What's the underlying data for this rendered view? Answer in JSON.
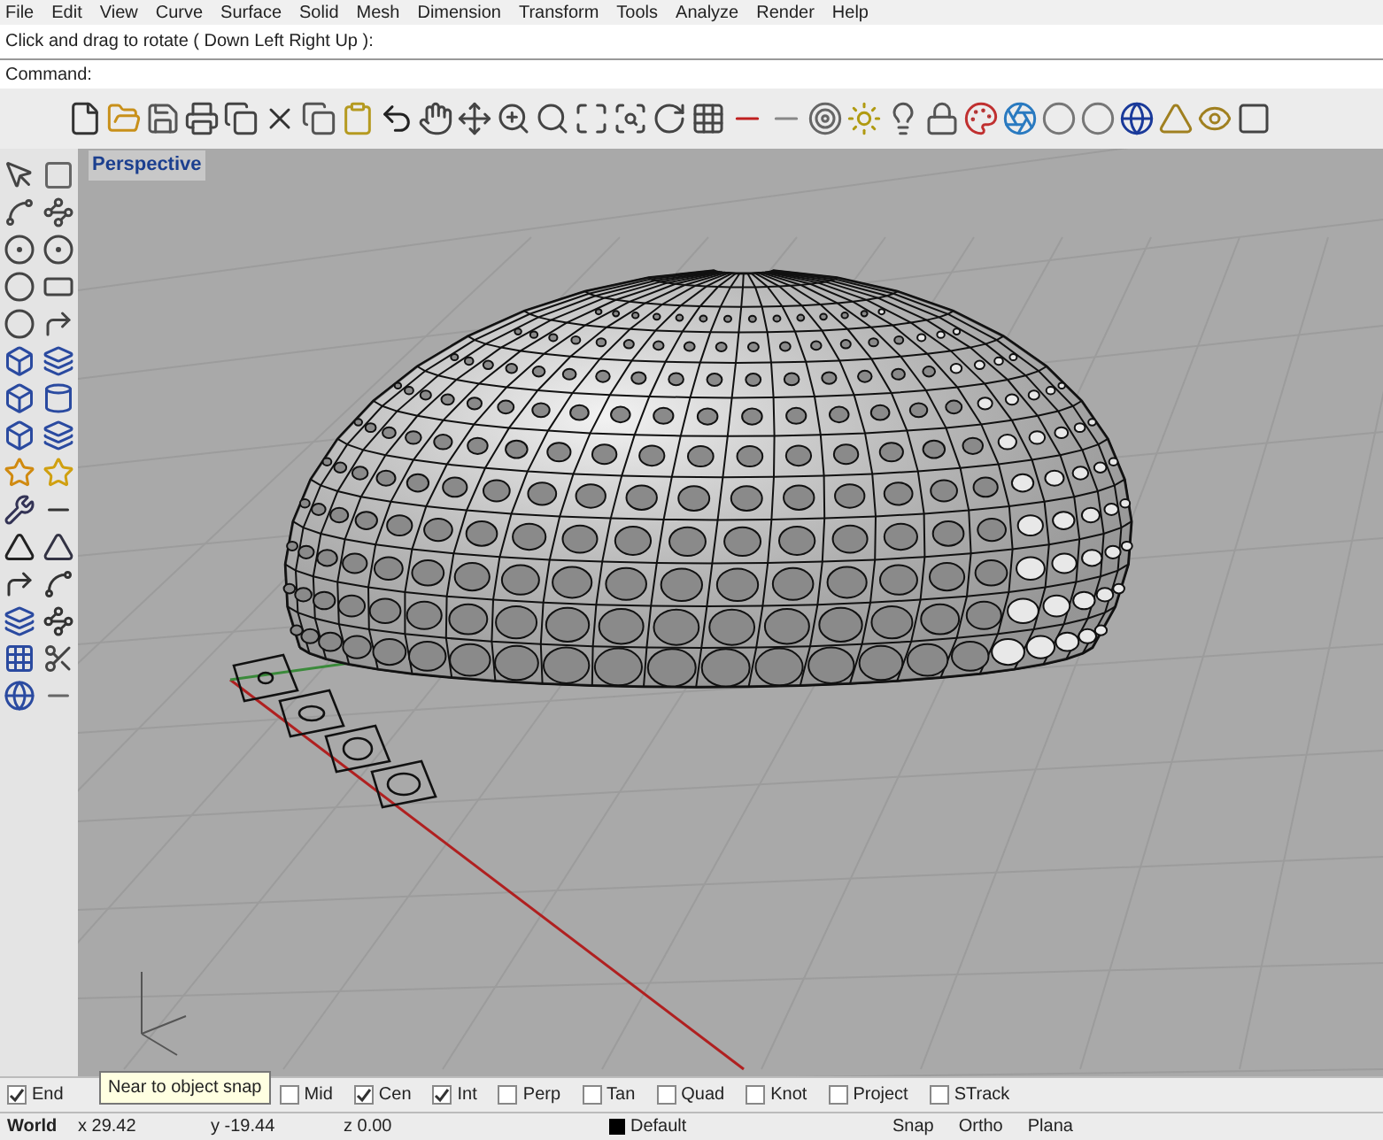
{
  "menu": [
    "File",
    "Edit",
    "View",
    "Curve",
    "Surface",
    "Solid",
    "Mesh",
    "Dimension",
    "Transform",
    "Tools",
    "Analyze",
    "Render",
    "Help"
  ],
  "prompt": "Click and drag to rotate ( Down  Left  Right  Up ):",
  "command": {
    "label": "Command:"
  },
  "viewport": {
    "title": "Perspective"
  },
  "osnaps": [
    {
      "label": "End",
      "checked": true
    },
    {
      "label": "Mid",
      "checked": false
    },
    {
      "label": "Cen",
      "checked": true
    },
    {
      "label": "Int",
      "checked": true
    },
    {
      "label": "Perp",
      "checked": false
    },
    {
      "label": "Tan",
      "checked": false
    },
    {
      "label": "Quad",
      "checked": false
    },
    {
      "label": "Knot",
      "checked": false
    },
    {
      "label": "Project",
      "checked": false
    },
    {
      "label": "STrack",
      "checked": false
    }
  ],
  "tooltip": "Near to object snap",
  "status_bar": {
    "cplane": "World",
    "x": "x 29.42",
    "y": "y -19.44",
    "z": "z 0.00",
    "layer": "Default",
    "toggles": [
      "Snap",
      "Ortho",
      "Plana"
    ]
  }
}
